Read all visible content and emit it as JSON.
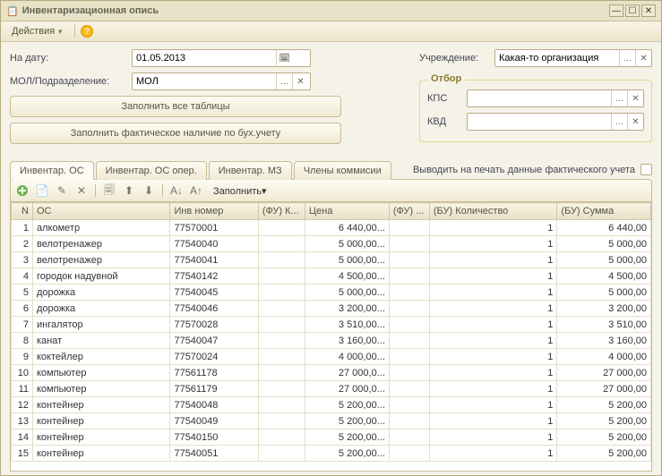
{
  "window": {
    "title": "Инвентаризационная опись"
  },
  "toolbar": {
    "actions": "Действия"
  },
  "form": {
    "date_label": "На дату:",
    "date_value": "01.05.2013",
    "mol_label": "МОЛ/Подразделение:",
    "mol_value": "МОЛ",
    "fill_all": "Заполнить все таблицы",
    "fill_fact": "Заполнить фактическое наличие по бух.учету",
    "org_label": "Учреждение:",
    "org_value": "Какая-то организация",
    "filter_legend": "Отбор",
    "kps_label": "КПС",
    "kvd_label": "КВД",
    "print_label": "Выводить на печать данные фактического учета"
  },
  "tabs": {
    "t0": "Инвентар. ОС",
    "t1": "Инвентар. ОС опер.",
    "t2": "Инвентар. МЗ",
    "t3": "Члены коммисии"
  },
  "gridtoolbar": {
    "fill": "Заполнить"
  },
  "columns": {
    "n": "N",
    "os": "ОС",
    "inv": "Инв номер",
    "fuk": "(ФУ) К...",
    "price": "Цена",
    "fu": "(ФУ) ...",
    "buq": "(БУ) Количество",
    "bus": "(БУ) Сумма"
  },
  "rows": [
    {
      "n": "1",
      "os": "алкометр",
      "inv": "77570001",
      "price": "6 440,00...",
      "buq": "1",
      "bus": "6 440,00"
    },
    {
      "n": "2",
      "os": "велотренажер",
      "inv": "77540040",
      "price": "5 000,00...",
      "buq": "1",
      "bus": "5 000,00"
    },
    {
      "n": "3",
      "os": "велотренажер",
      "inv": "77540041",
      "price": "5 000,00...",
      "buq": "1",
      "bus": "5 000,00"
    },
    {
      "n": "4",
      "os": "городок надувной",
      "inv": "77540142",
      "price": "4 500,00...",
      "buq": "1",
      "bus": "4 500,00"
    },
    {
      "n": "5",
      "os": "дорожка",
      "inv": "77540045",
      "price": "5 000,00...",
      "buq": "1",
      "bus": "5 000,00"
    },
    {
      "n": "6",
      "os": "дорожка",
      "inv": "77540046",
      "price": "3 200,00...",
      "buq": "1",
      "bus": "3 200,00"
    },
    {
      "n": "7",
      "os": "ингалятор",
      "inv": "77570028",
      "price": "3 510,00...",
      "buq": "1",
      "bus": "3 510,00"
    },
    {
      "n": "8",
      "os": "канат",
      "inv": "77540047",
      "price": "3 160,00...",
      "buq": "1",
      "bus": "3 160,00"
    },
    {
      "n": "9",
      "os": "коктейлер",
      "inv": "77570024",
      "price": "4 000,00...",
      "buq": "1",
      "bus": "4 000,00"
    },
    {
      "n": "10",
      "os": "компьютер",
      "inv": "77561178",
      "price": "27 000,0...",
      "buq": "1",
      "bus": "27 000,00"
    },
    {
      "n": "11",
      "os": "компьютер",
      "inv": "77561179",
      "price": "27 000,0...",
      "buq": "1",
      "bus": "27 000,00"
    },
    {
      "n": "12",
      "os": "контейнер",
      "inv": "77540048",
      "price": "5 200,00...",
      "buq": "1",
      "bus": "5 200,00"
    },
    {
      "n": "13",
      "os": "контейнер",
      "inv": "77540049",
      "price": "5 200,00...",
      "buq": "1",
      "bus": "5 200,00"
    },
    {
      "n": "14",
      "os": "контейнер",
      "inv": "77540150",
      "price": "5 200,00...",
      "buq": "1",
      "bus": "5 200,00"
    },
    {
      "n": "15",
      "os": "контейнер",
      "inv": "77540051",
      "price": "5 200,00...",
      "buq": "1",
      "bus": "5 200,00"
    }
  ]
}
